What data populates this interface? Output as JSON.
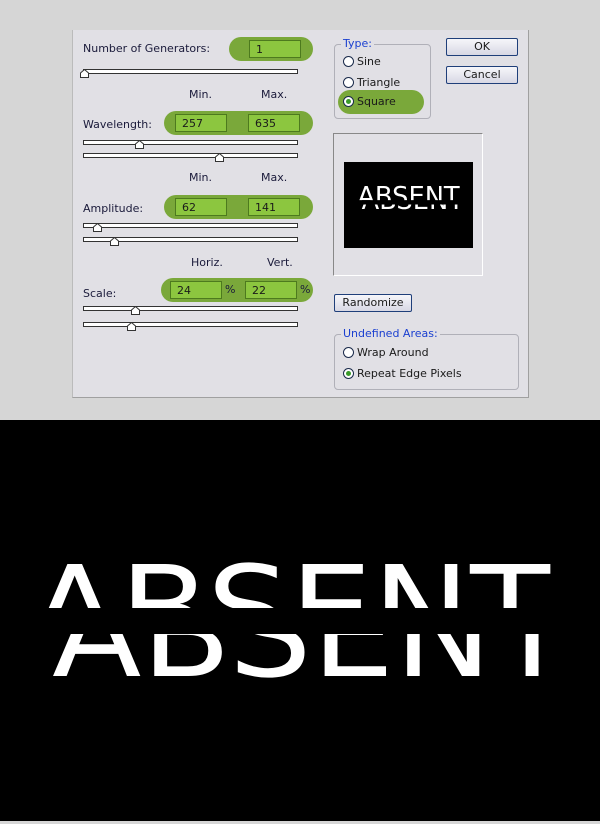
{
  "generators": {
    "label": "Number of Generators:",
    "value": "1",
    "fraction": 0.0
  },
  "minmax_labels": {
    "min": "Min.",
    "max": "Max."
  },
  "wavelength": {
    "label": "Wavelength:",
    "min": "257",
    "max": "635",
    "min_fraction": 0.257,
    "max_fraction": 0.635
  },
  "amplitude": {
    "label": "Amplitude:",
    "min": "62",
    "max": "141",
    "min_fraction": 0.062,
    "max_fraction": 0.141
  },
  "scale": {
    "label": "Scale:",
    "horiz_label": "Horiz.",
    "vert_label": "Vert.",
    "horiz": "24",
    "vert": "22",
    "unit": "%",
    "horiz_fraction": 0.24,
    "vert_fraction": 0.22
  },
  "type": {
    "title": "Type:",
    "options": [
      "Sine",
      "Triangle",
      "Square"
    ],
    "selected": "Square"
  },
  "buttons": {
    "ok": "OK",
    "cancel": "Cancel",
    "randomize": "Randomize"
  },
  "undefined_areas": {
    "title": "Undefined Areas:",
    "options": [
      "Wrap Around",
      "Repeat Edge Pixels"
    ],
    "selected": "Repeat Edge Pixels"
  },
  "preview_text": "ABSENT",
  "colors": {
    "highlight": "#7aa83a",
    "field": "#8cc63f",
    "accent": "#1a3fd0"
  }
}
